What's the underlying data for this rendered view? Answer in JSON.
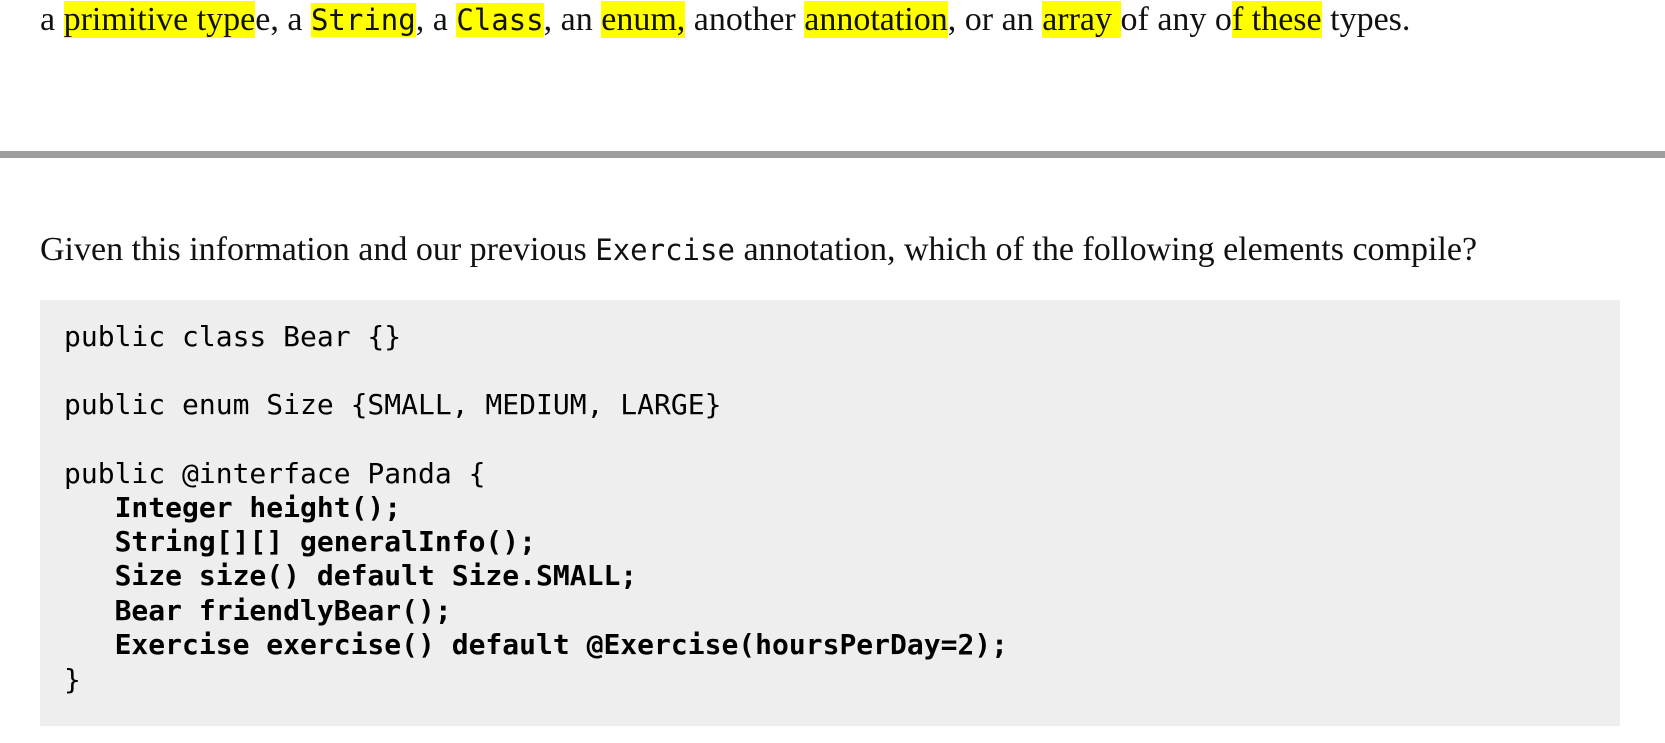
{
  "intro_line": {
    "segments": [
      {
        "text": "a ",
        "style": "plain"
      },
      {
        "text": "primitive type",
        "style": "highlight"
      },
      {
        "text": "e, a ",
        "style": "plain"
      },
      {
        "text": "String",
        "style": "highlight-mono"
      },
      {
        "text": ", a ",
        "style": "plain"
      },
      {
        "text": "Class",
        "style": "highlight-mono"
      },
      {
        "text": ", an ",
        "style": "plain"
      },
      {
        "text": "enum,",
        "style": "highlight"
      },
      {
        "text": " another ",
        "style": "plain"
      },
      {
        "text": "annotation",
        "style": "highlight"
      },
      {
        "text": ", or an ",
        "style": "plain"
      },
      {
        "text": "array ",
        "style": "highlight"
      },
      {
        "text": "of any o",
        "style": "plain"
      },
      {
        "text": "f these",
        "style": "highlight"
      },
      {
        "text": " types.",
        "style": "plain"
      }
    ]
  },
  "question": {
    "before": "Given this information and our previous ",
    "code": "Exercise",
    "after": " annotation, which of the following elements compile?"
  },
  "code": {
    "lines": [
      {
        "text": "public class Bear {}",
        "bold": false
      },
      {
        "text": "public enum Size {SMALL, MEDIUM, LARGE}",
        "bold": false
      },
      {
        "text": "public @interface Panda {",
        "bold": false
      },
      {
        "text": "   Integer height();",
        "bold": true
      },
      {
        "text": "   String[][] generalInfo();",
        "bold": true
      },
      {
        "text": "   Size size() default Size.SMALL;",
        "bold": true
      },
      {
        "text": "   Bear friendlyBear();",
        "bold": true
      },
      {
        "text": "   Exercise exercise() default @Exercise(hoursPerDay=2);",
        "bold": true
      },
      {
        "text": "}",
        "bold": false
      }
    ]
  },
  "colors": {
    "highlight": "#ffff00",
    "code_background": "#eeeeee",
    "divider": "#9e9e9e"
  }
}
